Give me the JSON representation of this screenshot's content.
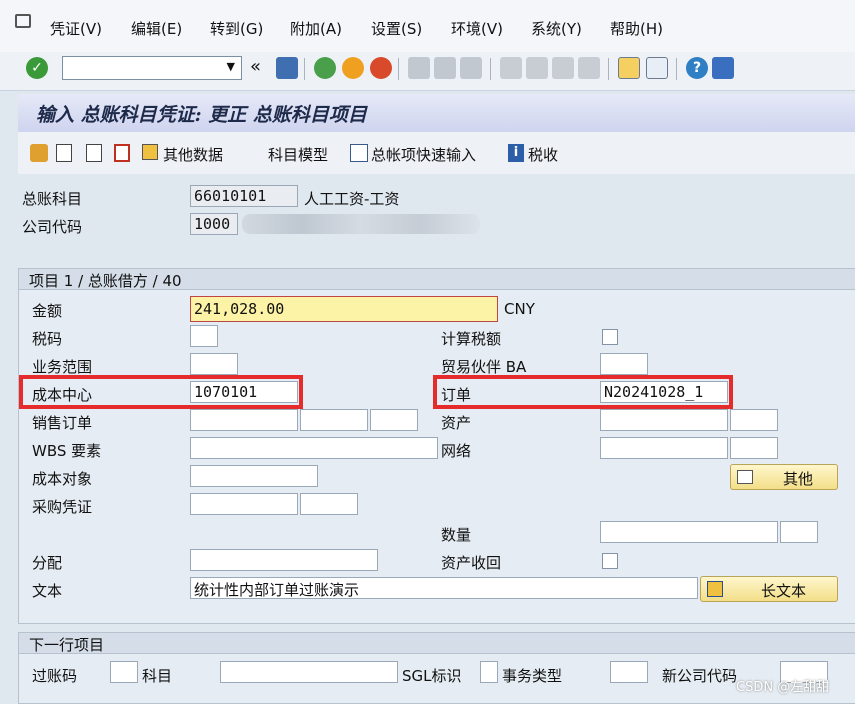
{
  "menu": {
    "items": [
      "凭证(V)",
      "编辑(E)",
      "转到(G)",
      "附加(A)",
      "设置(S)",
      "环境(V)",
      "系统(Y)",
      "帮助(H)"
    ]
  },
  "toolbar": {
    "command_value": ""
  },
  "page": {
    "title": "输入 总账科目凭证: 更正 总账科目项目"
  },
  "app_toolbar": {
    "more_data": "其他数据",
    "account_model": "科目模型",
    "fast_entry": "总帐项快速输入",
    "tax": "税收"
  },
  "header": {
    "gl_account_label": "总账科目",
    "gl_account_value": "66010101",
    "gl_account_desc": "人工工资-工资",
    "company_code_label": "公司代码",
    "company_code_value": "1000"
  },
  "item_section": {
    "title": "项目 1 / 总账借方 / 40",
    "amount_label": "金额",
    "amount_value": "241,028.00",
    "currency": "CNY",
    "tax_code_label": "税码",
    "calc_tax_label": "计算税额",
    "business_area_label": "业务范围",
    "trading_partner_label": "贸易伙伴 BA",
    "cost_center_label": "成本中心",
    "cost_center_value": "1070101",
    "order_label": "订单",
    "order_value": "N20241028_1",
    "sales_order_label": "销售订单",
    "asset_label": "资产",
    "wbs_label": "WBS 要素",
    "network_label": "网络",
    "cost_object_label": "成本对象",
    "more_button": "其他",
    "purchase_doc_label": "采购凭证",
    "quantity_label": "数量",
    "assignment_label": "分配",
    "asset_retire_label": "资产收回",
    "text_label": "文本",
    "text_value": "统计性内部订单过账演示",
    "long_text_button": "长文本"
  },
  "next_item": {
    "title": "下一行项目",
    "posting_key_label": "过账码",
    "account_label": "科目",
    "sgl_label": "SGL标识",
    "trans_type_label": "事务类型",
    "new_company_label": "新公司代码"
  },
  "watermark": "CSDN @左甜甜",
  "colors": {
    "highlight_red": "#e52b2b",
    "amount_yellow": "#fdf3a6"
  }
}
